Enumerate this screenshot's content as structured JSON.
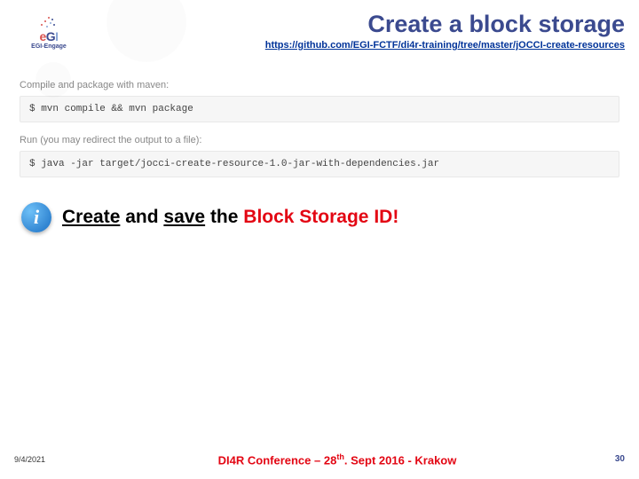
{
  "logo": {
    "brand": "eGI",
    "sub": "EGI-Engage"
  },
  "header": {
    "title": "Create a block storage",
    "link": "https://github.com/EGI-FCTF/di4r-training/tree/master/jOCCI-create-resources"
  },
  "steps": {
    "compile_label": "Compile and package with maven:",
    "compile_cmd": "$ mvn compile && mvn package",
    "run_label": "Run (you may redirect the output to a file):",
    "run_cmd": "$ java -jar target/jocci-create-resource-1.0-jar-with-dependencies.jar"
  },
  "callout": {
    "create": "Create",
    "and": " and ",
    "save": "save",
    "tail": " the ",
    "highlight": "Block Storage ID!"
  },
  "footer": {
    "date": "9/4/2021",
    "conference_prefix": "DI4R Conference – 28",
    "conference_suffix": ". Sept 2016 - Krakow",
    "ordinal": "th",
    "page": "30"
  }
}
